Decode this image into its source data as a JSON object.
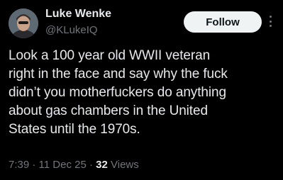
{
  "author": {
    "display_name": "Luke Wenke",
    "handle": "@KLukeIQ"
  },
  "actions": {
    "follow_label": "Follow",
    "more_icon": "more-vertical-icon"
  },
  "tweet": {
    "text_lines": [
      "Look a 100 year old WWII veteran",
      "right in the face and say why the fuck",
      "didn’t you motherfuckers do anything",
      "about gas chambers in the United",
      "States until the 1970s."
    ],
    "time": "7:39",
    "separator": "·",
    "date": "11 Dec 25",
    "views_count": "32",
    "views_label": "Views"
  },
  "colors": {
    "background": "#000000",
    "primary_text": "#e7e9ea",
    "secondary_text": "#71767b",
    "follow_button_bg": "#eff3f4",
    "follow_button_text": "#0f1419"
  }
}
